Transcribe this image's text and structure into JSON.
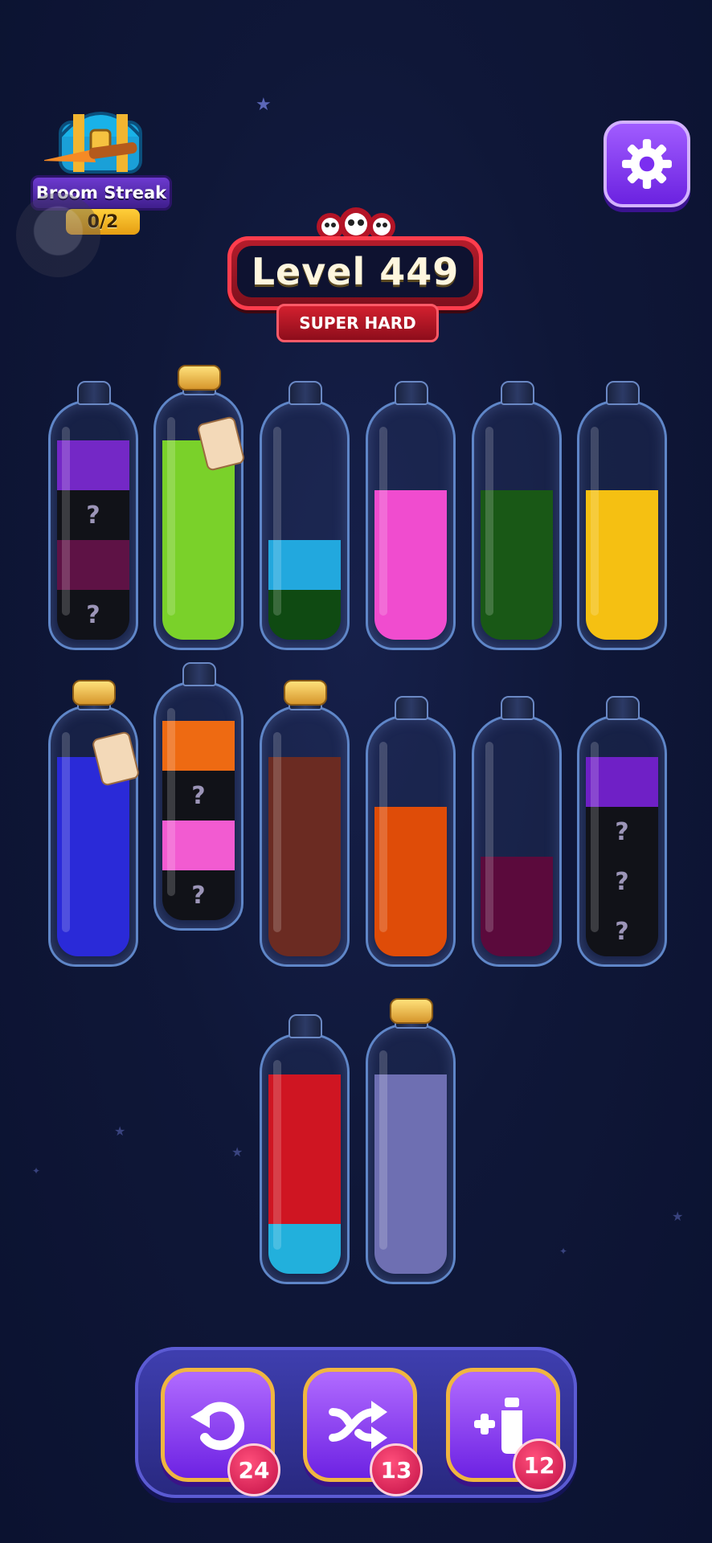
{
  "streak": {
    "title": "Broom Streak",
    "count": "0/2"
  },
  "level": {
    "title": "Level 449",
    "difficulty": "SUPER HARD"
  },
  "bottles": [
    {
      "segments": [
        {
          "color": "#111218",
          "hidden": true
        },
        {
          "color": "#5e1245",
          "hidden": false
        },
        {
          "color": "#111218",
          "hidden": true
        },
        {
          "color": "#7428c6",
          "hidden": false
        }
      ],
      "cap": "none"
    },
    {
      "segments": [
        {
          "color": "#7ad12a"
        },
        {
          "color": "#7ad12a"
        },
        {
          "color": "#7ad12a"
        },
        {
          "color": "#7ad12a"
        }
      ],
      "cap": "cork-tag"
    },
    {
      "segments": [
        {
          "color": "#0f4a12"
        },
        {
          "color": "#22a8de"
        }
      ],
      "cap": "none"
    },
    {
      "segments": [
        {
          "color": "#f04ccf"
        },
        {
          "color": "#f04ccf"
        },
        {
          "color": "#f04ccf"
        }
      ],
      "cap": "none"
    },
    {
      "segments": [
        {
          "color": "#195816"
        },
        {
          "color": "#195816"
        },
        {
          "color": "#195816"
        }
      ],
      "cap": "none"
    },
    {
      "segments": [
        {
          "color": "#f5c012"
        },
        {
          "color": "#f5c012"
        },
        {
          "color": "#f5c012"
        }
      ],
      "cap": "none"
    },
    {
      "segments": [
        {
          "color": "#2a2ad8"
        },
        {
          "color": "#2a2ad8"
        },
        {
          "color": "#2a2ad8"
        },
        {
          "color": "#2a2ad8"
        }
      ],
      "cap": "cork-tag"
    },
    {
      "segments": [
        {
          "color": "#111218",
          "hidden": true
        },
        {
          "color": "#f25bd1"
        },
        {
          "color": "#111218",
          "hidden": true
        },
        {
          "color": "#ee6a12"
        }
      ],
      "cap": "none"
    },
    {
      "segments": [
        {
          "color": "#6b2b22"
        },
        {
          "color": "#6b2b22"
        },
        {
          "color": "#6b2b22"
        },
        {
          "color": "#6b2b22"
        }
      ],
      "cap": "cork"
    },
    {
      "segments": [
        {
          "color": "#df4c08"
        },
        {
          "color": "#df4c08"
        },
        {
          "color": "#df4c08"
        }
      ],
      "cap": "none"
    },
    {
      "segments": [
        {
          "color": "#5b0a3c"
        },
        {
          "color": "#5b0a3c"
        }
      ],
      "cap": "none"
    },
    {
      "segments": [
        {
          "color": "#111218",
          "hidden": true
        },
        {
          "color": "#111218",
          "hidden": true
        },
        {
          "color": "#111218",
          "hidden": true
        },
        {
          "color": "#6f20c6"
        }
      ],
      "cap": "none"
    },
    {
      "segments": [
        {
          "color": "#22b0dc"
        },
        {
          "color": "#cf1522"
        },
        {
          "color": "#cf1522"
        },
        {
          "color": "#cf1522"
        }
      ],
      "cap": "none"
    },
    {
      "segments": [
        {
          "color": "#6e6fb2"
        },
        {
          "color": "#6e6fb2"
        },
        {
          "color": "#6e6fb2"
        },
        {
          "color": "#6e6fb2"
        }
      ],
      "cap": "cork"
    }
  ],
  "tools": {
    "undo": {
      "count": "24"
    },
    "shuffle": {
      "count": "13"
    },
    "add_bottle": {
      "count": "12"
    }
  },
  "hidden_mark": "?"
}
